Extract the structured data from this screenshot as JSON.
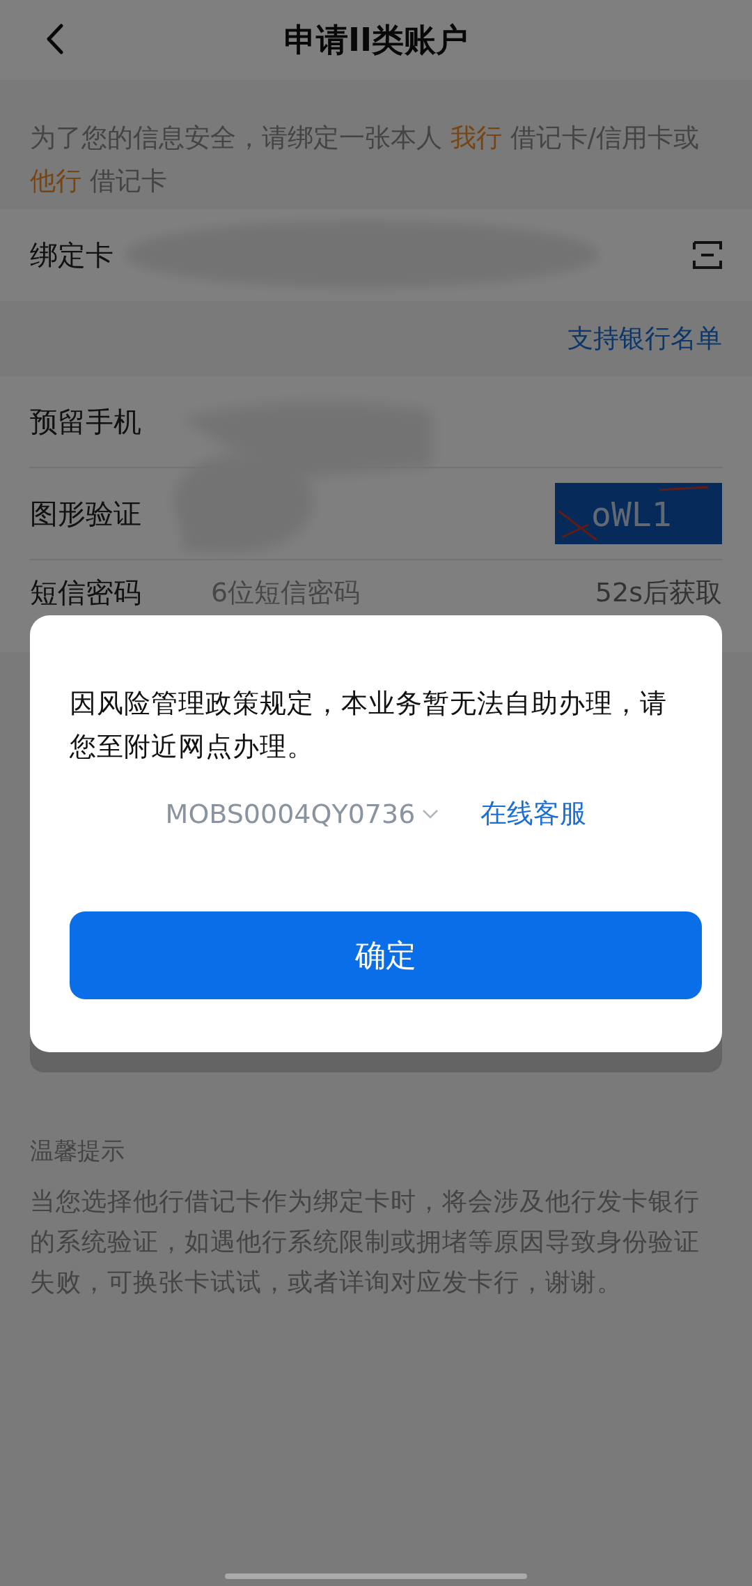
{
  "header": {
    "title": "申请II类账户"
  },
  "notice": [
    {
      "kind": "plain",
      "text": "为了您的信息安全，请绑定一张本人 "
    },
    {
      "kind": "highlight",
      "text": "我行"
    },
    {
      "kind": "plain",
      "text": " 借记卡/信用卡或 "
    },
    {
      "kind": "highlight",
      "text": "他行"
    },
    {
      "kind": "plain",
      "text": " 借记卡"
    }
  ],
  "card_row": {
    "label": "绑定卡"
  },
  "bank_list_link": "支持银行名单",
  "rows": [
    {
      "kind": "text",
      "label": "预留手机"
    },
    {
      "kind": "captcha",
      "label": "图形验证",
      "captcha": "oWL1"
    },
    {
      "kind": "sms",
      "label": "短信密码",
      "placeholder": "6位短信密码",
      "action": "52s后获取"
    }
  ],
  "tips": {
    "title": "温馨提示",
    "body": "当您选择他行借记卡作为绑定卡时，将会涉及他行发卡银行的系统验证，如遇他行系统限制或拥堵等原因导致身份验证失败，可换张卡试试，或者详询对应发卡行，谢谢。"
  },
  "dialog": {
    "message": "因风险管理政策规定，本业务暂无法自助办理，请您至附近网点办理。",
    "code": "MOBS0004QY0736",
    "link": "在线客服",
    "confirm": "确定"
  }
}
